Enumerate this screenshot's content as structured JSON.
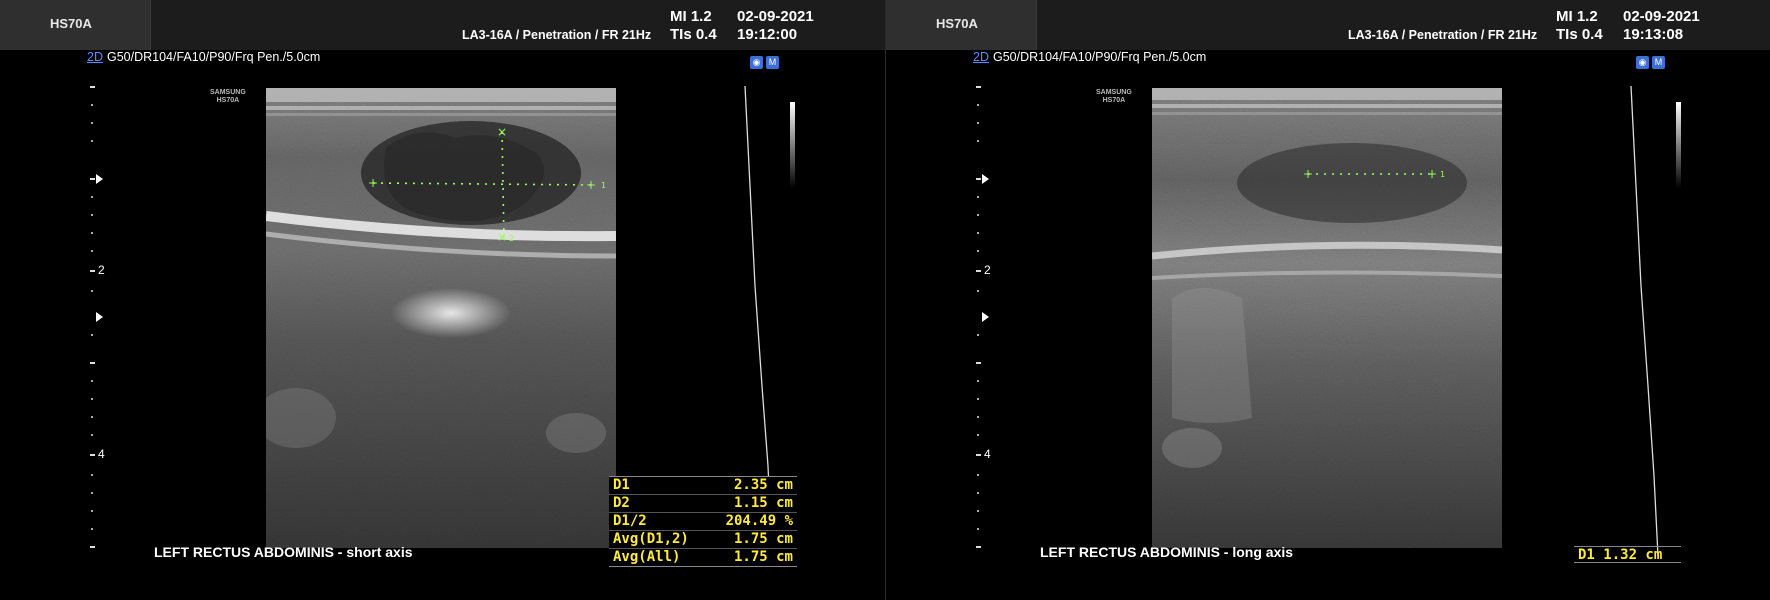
{
  "panels": [
    {
      "model": "HS70A",
      "probe_info": "LA3-16A / Penetration / FR 21Hz",
      "mi": "MI  1.2",
      "tis": "TIs 0.4",
      "date": "02-09-2021",
      "time": "19:12:00",
      "mode": "2D",
      "params": "G50/DR104/FA10/P90/Frq Pen./5.0cm",
      "brand_line1": "SAMSUNG",
      "brand_line2": "HS70A",
      "depth_label_2": "2",
      "depth_label_4": "4",
      "caption": "LEFT RECTUS ABDOMINIS - short axis",
      "measurements": [
        {
          "label": "D1",
          "value": "2.35 cm"
        },
        {
          "label": "D2",
          "value": "1.15 cm"
        },
        {
          "label": "D1/2",
          "value": "204.49 %"
        },
        {
          "label": "Avg(D1,2)",
          "value": "1.75 cm"
        },
        {
          "label": "Avg(All)",
          "value": "1.75 cm"
        }
      ],
      "caliper_labels": {
        "d1": "1",
        "d2": "2"
      }
    },
    {
      "model": "HS70A",
      "probe_info": "LA3-16A / Penetration / FR 21Hz",
      "mi": "MI  1.2",
      "tis": "TIs 0.4",
      "date": "02-09-2021",
      "time": "19:13:08",
      "mode": "2D",
      "params": "G50/DR104/FA10/P90/Frq Pen./5.0cm",
      "brand_line1": "SAMSUNG",
      "brand_line2": "HS70A",
      "depth_label_2": "2",
      "depth_label_4": "4",
      "caption": "LEFT RECTUS ABDOMINIS - long axis",
      "measurement_single": "D1  1.32 cm",
      "caliper_labels": {
        "d1": "1"
      }
    }
  ],
  "colors": {
    "measurement_text": "#ffeb3b",
    "mode_link": "#5a8cff",
    "caliper": "#9cff5a"
  },
  "icons": [
    "freeze-icon",
    "mode-icon"
  ]
}
